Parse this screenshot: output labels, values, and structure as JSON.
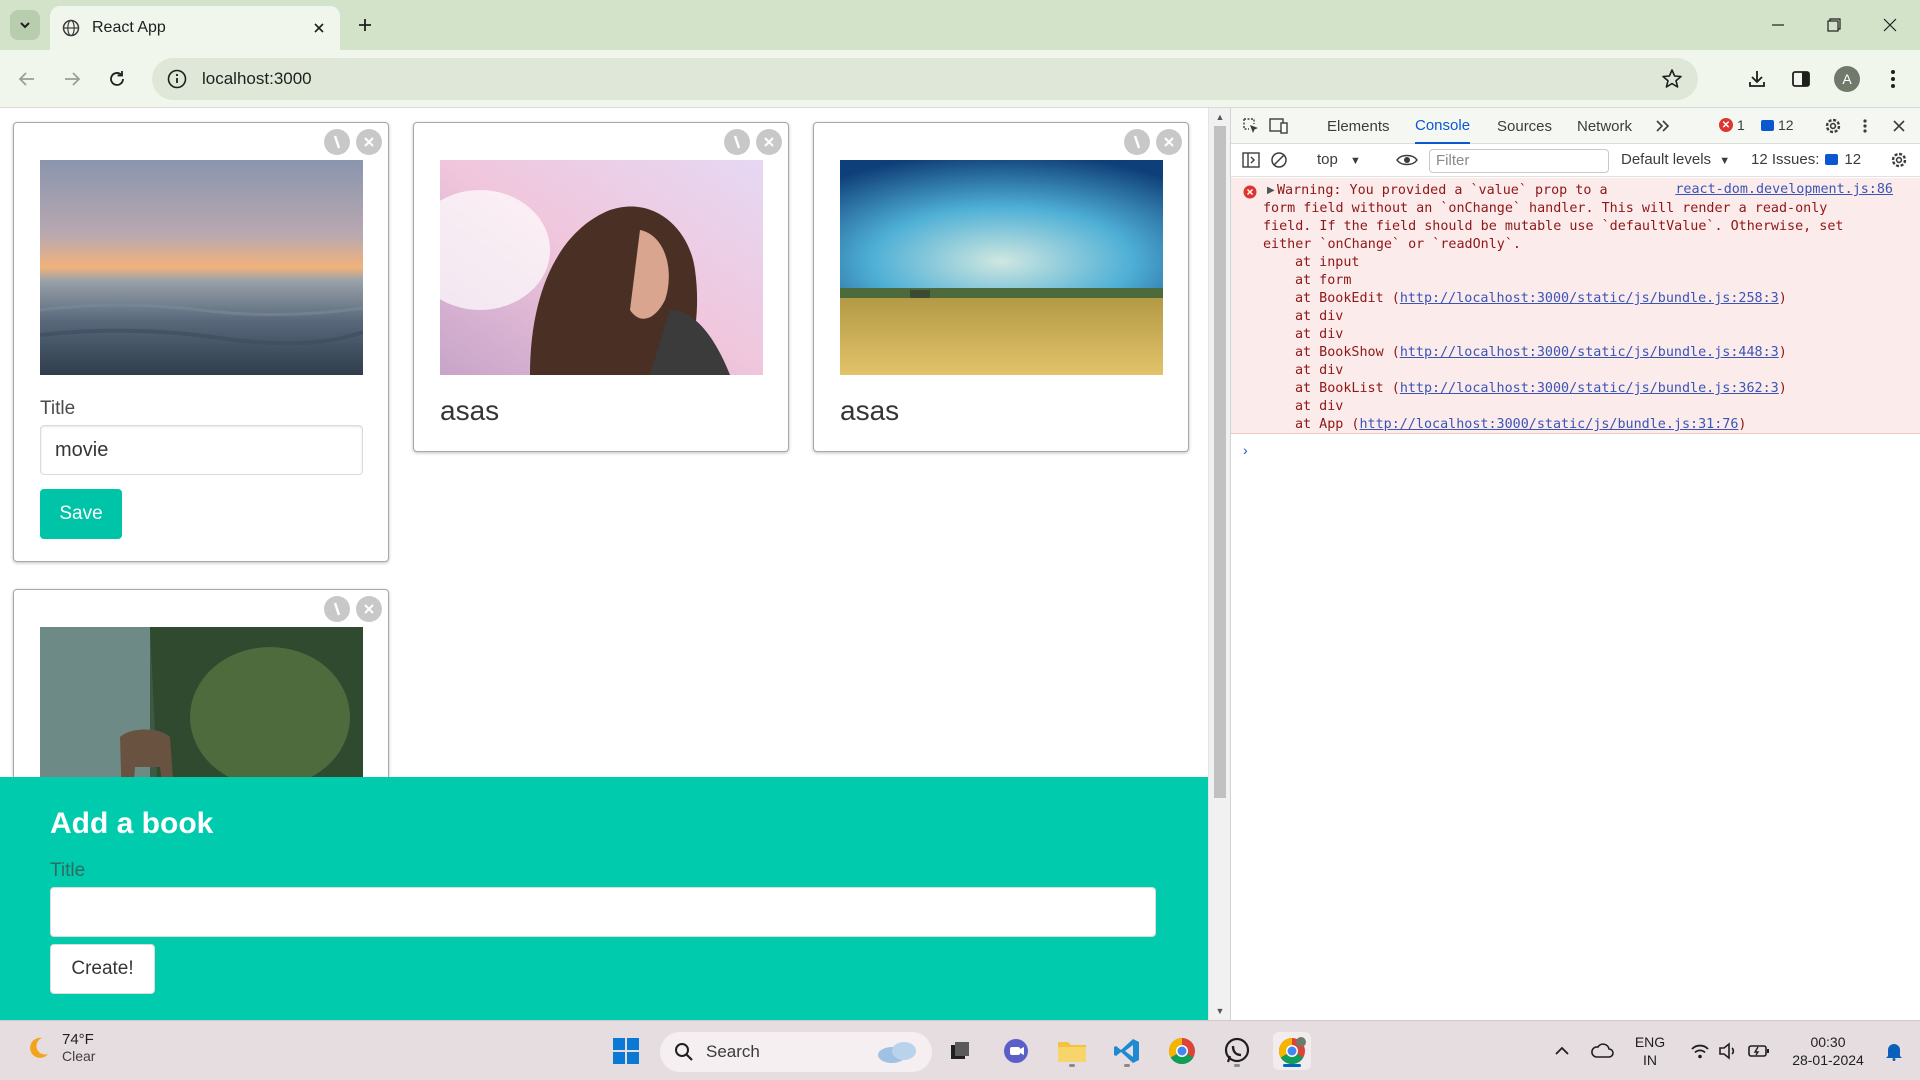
{
  "browser": {
    "tab_title": "React App",
    "url": "localhost:3000",
    "avatar_letter": "A"
  },
  "page": {
    "edit_card": {
      "title_label": "Title",
      "title_value": "movie",
      "save_label": "Save"
    },
    "book_cards": [
      {
        "title": "asas"
      },
      {
        "title": "asas"
      }
    ],
    "add_book": {
      "heading": "Add a book",
      "title_label": "Title",
      "title_value": "",
      "create_label": "Create!"
    },
    "accent_color": "#00ccad"
  },
  "devtools": {
    "tabs": [
      "Elements",
      "Console",
      "Sources",
      "Network"
    ],
    "active_tab": "Console",
    "error_count": "1",
    "message_count": "12",
    "context": "top",
    "filter_placeholder": "Filter",
    "levels": "Default levels",
    "issues_label": "12 Issues:",
    "issues_count": "12",
    "warning": {
      "text": "Warning: You provided a `value` prop to a\nform field without an `onChange` handler. This will render a read-only\nfield. If the field should be mutable use `defaultValue`. Otherwise, set\neither `onChange` or `readOnly`.",
      "source": "react-dom.development.js:86",
      "stack": [
        {
          "prefix": "at input",
          "link": "",
          "suffix": ""
        },
        {
          "prefix": "at form",
          "link": "",
          "suffix": ""
        },
        {
          "prefix": "at BookEdit (",
          "link": "http://localhost:3000/static/js/bundle.js:258:3",
          "suffix": ")"
        },
        {
          "prefix": "at div",
          "link": "",
          "suffix": ""
        },
        {
          "prefix": "at div",
          "link": "",
          "suffix": ""
        },
        {
          "prefix": "at BookShow (",
          "link": "http://localhost:3000/static/js/bundle.js:448:3",
          "suffix": ")"
        },
        {
          "prefix": "at div",
          "link": "",
          "suffix": ""
        },
        {
          "prefix": "at BookList (",
          "link": "http://localhost:3000/static/js/bundle.js:362:3",
          "suffix": ")"
        },
        {
          "prefix": "at div",
          "link": "",
          "suffix": ""
        },
        {
          "prefix": "at App (",
          "link": "http://localhost:3000/static/js/bundle.js:31:76",
          "suffix": ")"
        }
      ]
    }
  },
  "taskbar": {
    "temperature": "74°F",
    "condition": "Clear",
    "search_placeholder": "Search",
    "language": "ENG",
    "region": "IN",
    "time": "00:30",
    "date": "28-01-2024"
  }
}
